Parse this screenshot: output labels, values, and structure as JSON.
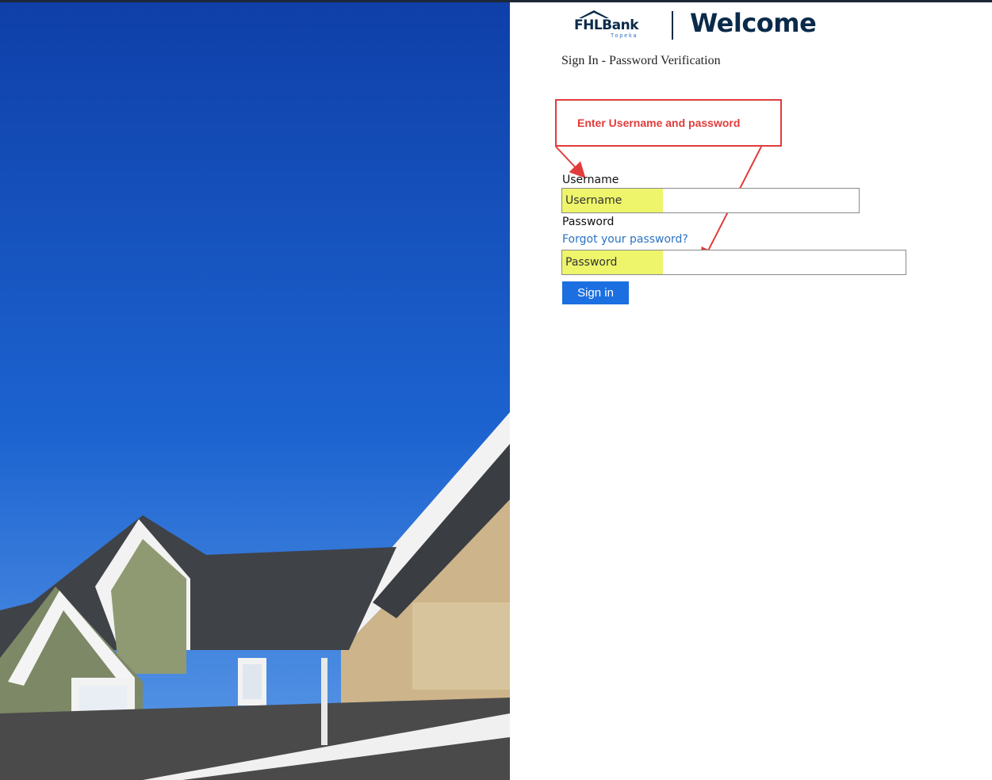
{
  "brand": {
    "name": "FHLBank",
    "sub": "Topeka"
  },
  "header": {
    "title": "Welcome",
    "subtitle": "Sign In - Password Verification"
  },
  "annotation": {
    "text": "Enter Username and password",
    "color": "#e23b3b"
  },
  "form": {
    "username_label": "Username",
    "username_placeholder": "Username",
    "password_label": "Password",
    "forgot_link": "Forgot your password?",
    "password_placeholder": "Password",
    "submit_label": "Sign in"
  },
  "colors": {
    "brand_navy": "#0a2a4a",
    "button_blue": "#1b6fe0",
    "link_blue": "#2b73c4",
    "highlight": "#eef56a"
  },
  "hero": {
    "image": "houses-under-blue-sky"
  }
}
